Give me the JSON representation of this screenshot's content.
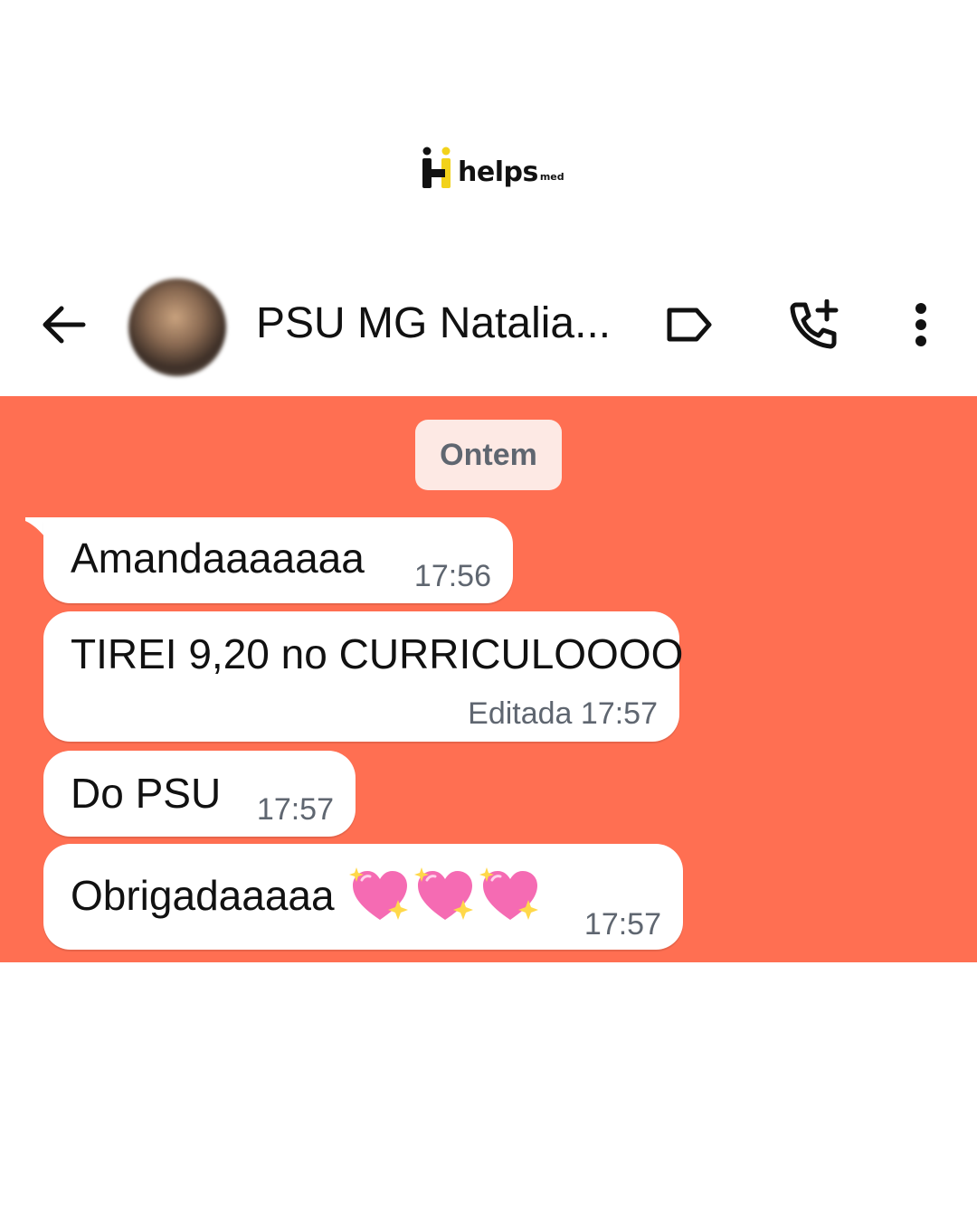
{
  "logo": {
    "wordmark": "helps",
    "suffix": "med",
    "accent_color": "#f2d21b"
  },
  "header": {
    "contact_name": "PSU MG Natalia...",
    "icons": [
      "back-arrow-icon",
      "avatar",
      "label-tag-icon",
      "add-call-icon",
      "more-vert-icon"
    ]
  },
  "chat": {
    "background_color": "#ff6f52",
    "date_separator": "Ontem",
    "messages": [
      {
        "text": "Amandaaaaaaa",
        "time": "17:56"
      },
      {
        "text": "TIREI 9,20 no CURRICULOOOO",
        "time": "Editada 17:57"
      },
      {
        "text": "Do PSU",
        "time": "17:57"
      },
      {
        "text": "Obrigadaaaaa",
        "emoji": [
          "sparkling-heart-icon",
          "sparkling-heart-icon",
          "sparkling-heart-icon"
        ],
        "time": "17:57"
      }
    ]
  }
}
